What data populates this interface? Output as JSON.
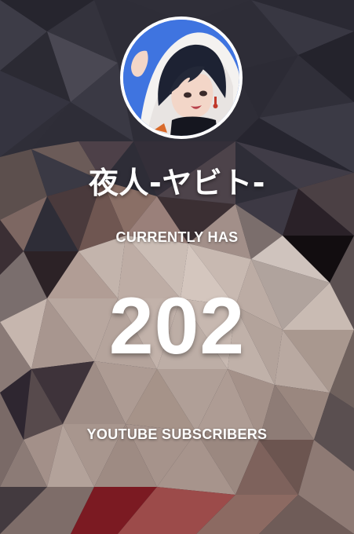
{
  "channel": {
    "name": "夜人-ヤビト-",
    "avatar_icon": "channel-avatar-anime-portrait"
  },
  "counter": {
    "caption_top": "CURRENTLY HAS",
    "count": "202",
    "caption_bottom": "YOUTUBE SUBSCRIBERS"
  },
  "theme": {
    "text_color": "#ffffff",
    "background_style": "low-poly triangles"
  }
}
